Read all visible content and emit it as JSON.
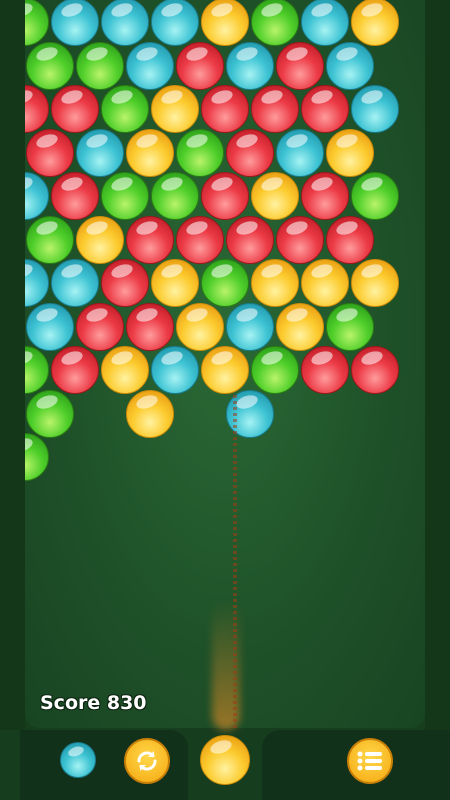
{
  "score": {
    "label": "Score 830"
  },
  "colors": {
    "green": "#4fcf2a",
    "cyan": "#3dc3d3",
    "red": "#ec3b47",
    "yellow": "#fccb2e",
    "board": "#1f5229",
    "button": "#f5a70f"
  },
  "grid": {
    "rows": [
      [
        "green",
        "cyan",
        "cyan",
        "cyan",
        "yellow",
        "green",
        "cyan",
        "yellow"
      ],
      [
        "green",
        "green",
        "cyan",
        "red",
        "cyan",
        "red",
        "cyan"
      ],
      [
        "red",
        "red",
        "green",
        "yellow",
        "red",
        "red",
        "red",
        "cyan"
      ],
      [
        "red",
        "cyan",
        "yellow",
        "green",
        "red",
        "cyan",
        "yellow"
      ],
      [
        "cyan",
        "red",
        "green",
        "green",
        "red",
        "yellow",
        "red",
        "green"
      ],
      [
        "green",
        "yellow",
        "red",
        "red",
        "red",
        "red",
        "red"
      ],
      [
        "cyan",
        "cyan",
        "red",
        "yellow",
        "green",
        "yellow",
        "yellow",
        "yellow"
      ],
      [
        "cyan",
        "red",
        "red",
        "yellow",
        "cyan",
        "yellow",
        "green"
      ],
      [
        "green",
        "red",
        "yellow",
        "cyan",
        "yellow",
        "green",
        "red",
        "red"
      ],
      [
        "green",
        null,
        "yellow",
        null,
        "cyan",
        null,
        null
      ],
      [
        "green",
        null,
        null,
        null,
        null,
        null,
        null,
        null
      ]
    ]
  },
  "shooter": {
    "color": "yellow",
    "icon": "bubble-icon"
  },
  "next_bubble": {
    "color": "cyan",
    "icon": "bubble-icon"
  },
  "buttons": {
    "swap": {
      "icon": "refresh-icon"
    },
    "menu": {
      "icon": "list-menu-icon"
    }
  }
}
